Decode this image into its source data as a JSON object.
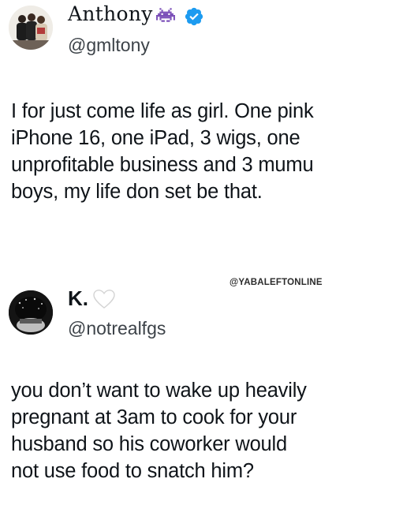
{
  "tweets": [
    {
      "display_name": "Anthony",
      "handle": "@gmltony",
      "badges": [
        "space-invader-emoji-icon",
        "verified-badge-icon"
      ],
      "text": "I for just come life as girl. One pink\niPhone 16, one iPad, 3 wigs, one\nunprofitable business and 3 mumu\nboys, my life don set be that."
    },
    {
      "display_name": "K.",
      "handle": "@notrealfgs",
      "badges": [
        "white-heart-icon"
      ],
      "text": "you don’t want to wake up heavily\npregnant at 3am to cook for your\nhusband so his coworker would\nnot use food to snatch him?"
    }
  ],
  "watermark": "@YABALEFTONLINE",
  "colors": {
    "text": "#0f1419",
    "handle": "#3d4349",
    "verified": "#1d9bf0",
    "invader": "#7b4fb8",
    "background": "#ffffff"
  }
}
